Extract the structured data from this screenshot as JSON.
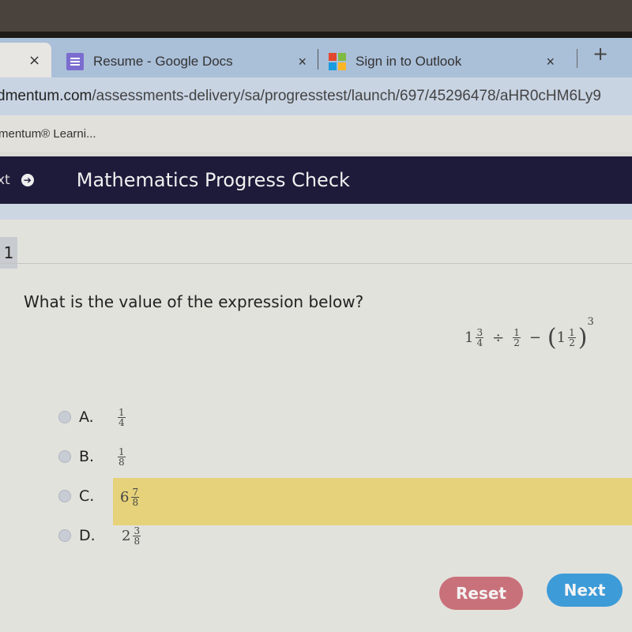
{
  "browser": {
    "tabs": [
      {
        "label": "Resume - Google Docs",
        "icon": "google-docs-icon"
      },
      {
        "label": "Sign in to Outlook",
        "icon": "microsoft-icon"
      }
    ],
    "close_glyph": "×",
    "new_tab_glyph": "+",
    "url_host": "dmentum.com",
    "url_path": "/assessments-delivery/sa/progresstest/launch/697/45296478/aHR0cHM6Ly9",
    "bookmark": "mentum® Learni..."
  },
  "header": {
    "prev_label": "xt",
    "prev_icon_glyph": "➔",
    "title": "Mathematics Progress Check"
  },
  "question": {
    "number": "1",
    "text": "What is the value of the expression below?",
    "expression": {
      "whole1": "1",
      "num1": "3",
      "den1": "4",
      "op1": "÷",
      "num2": "1",
      "den2": "2",
      "op2": "−",
      "paren_open": "(",
      "whole3": "1",
      "num3": "1",
      "den3": "2",
      "paren_close": ")",
      "exponent": "3"
    }
  },
  "options": [
    {
      "letter": "A.",
      "whole": "",
      "num": "1",
      "den": "4",
      "selected": false
    },
    {
      "letter": "B.",
      "whole": "",
      "num": "1",
      "den": "8",
      "selected": false
    },
    {
      "letter": "C.",
      "whole": "6",
      "num": "7",
      "den": "8",
      "selected": true
    },
    {
      "letter": "D.",
      "whole": "2",
      "num": "3",
      "den": "8",
      "selected": false
    }
  ],
  "buttons": {
    "reset": "Reset",
    "next": "Next"
  },
  "colors": {
    "header_bg": "#1e1a3a",
    "highlight": "#e6d27a",
    "reset": "#c9717a",
    "next": "#3d9bd8"
  }
}
